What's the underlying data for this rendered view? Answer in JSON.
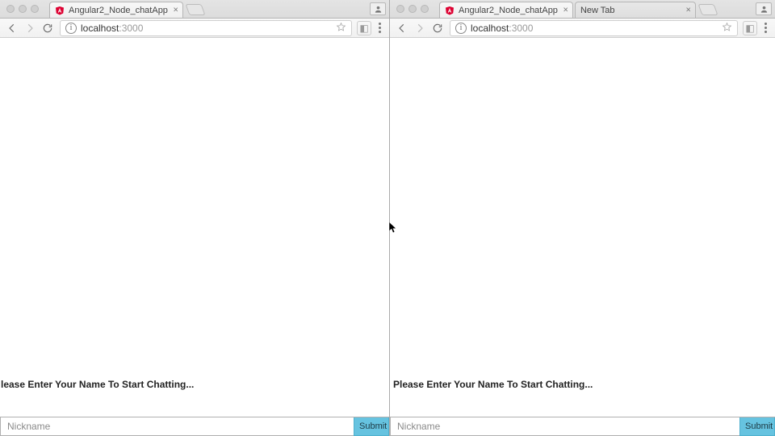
{
  "left": {
    "tabs": [
      {
        "title": "Angular2_Node_chatApp"
      }
    ],
    "url": {
      "host": "localhost",
      "port": ":3000"
    },
    "prompt": "lease Enter Your Name To Start Chatting...",
    "nick_placeholder": "Nickname",
    "submit_label": "Submit"
  },
  "right": {
    "tabs": [
      {
        "title": "Angular2_Node_chatApp"
      },
      {
        "title": "New Tab"
      }
    ],
    "url": {
      "host": "localhost",
      "port": ":3000"
    },
    "prompt": "Please Enter Your Name To Start Chatting...",
    "nick_placeholder": "Nickname",
    "submit_label": "Submit"
  }
}
